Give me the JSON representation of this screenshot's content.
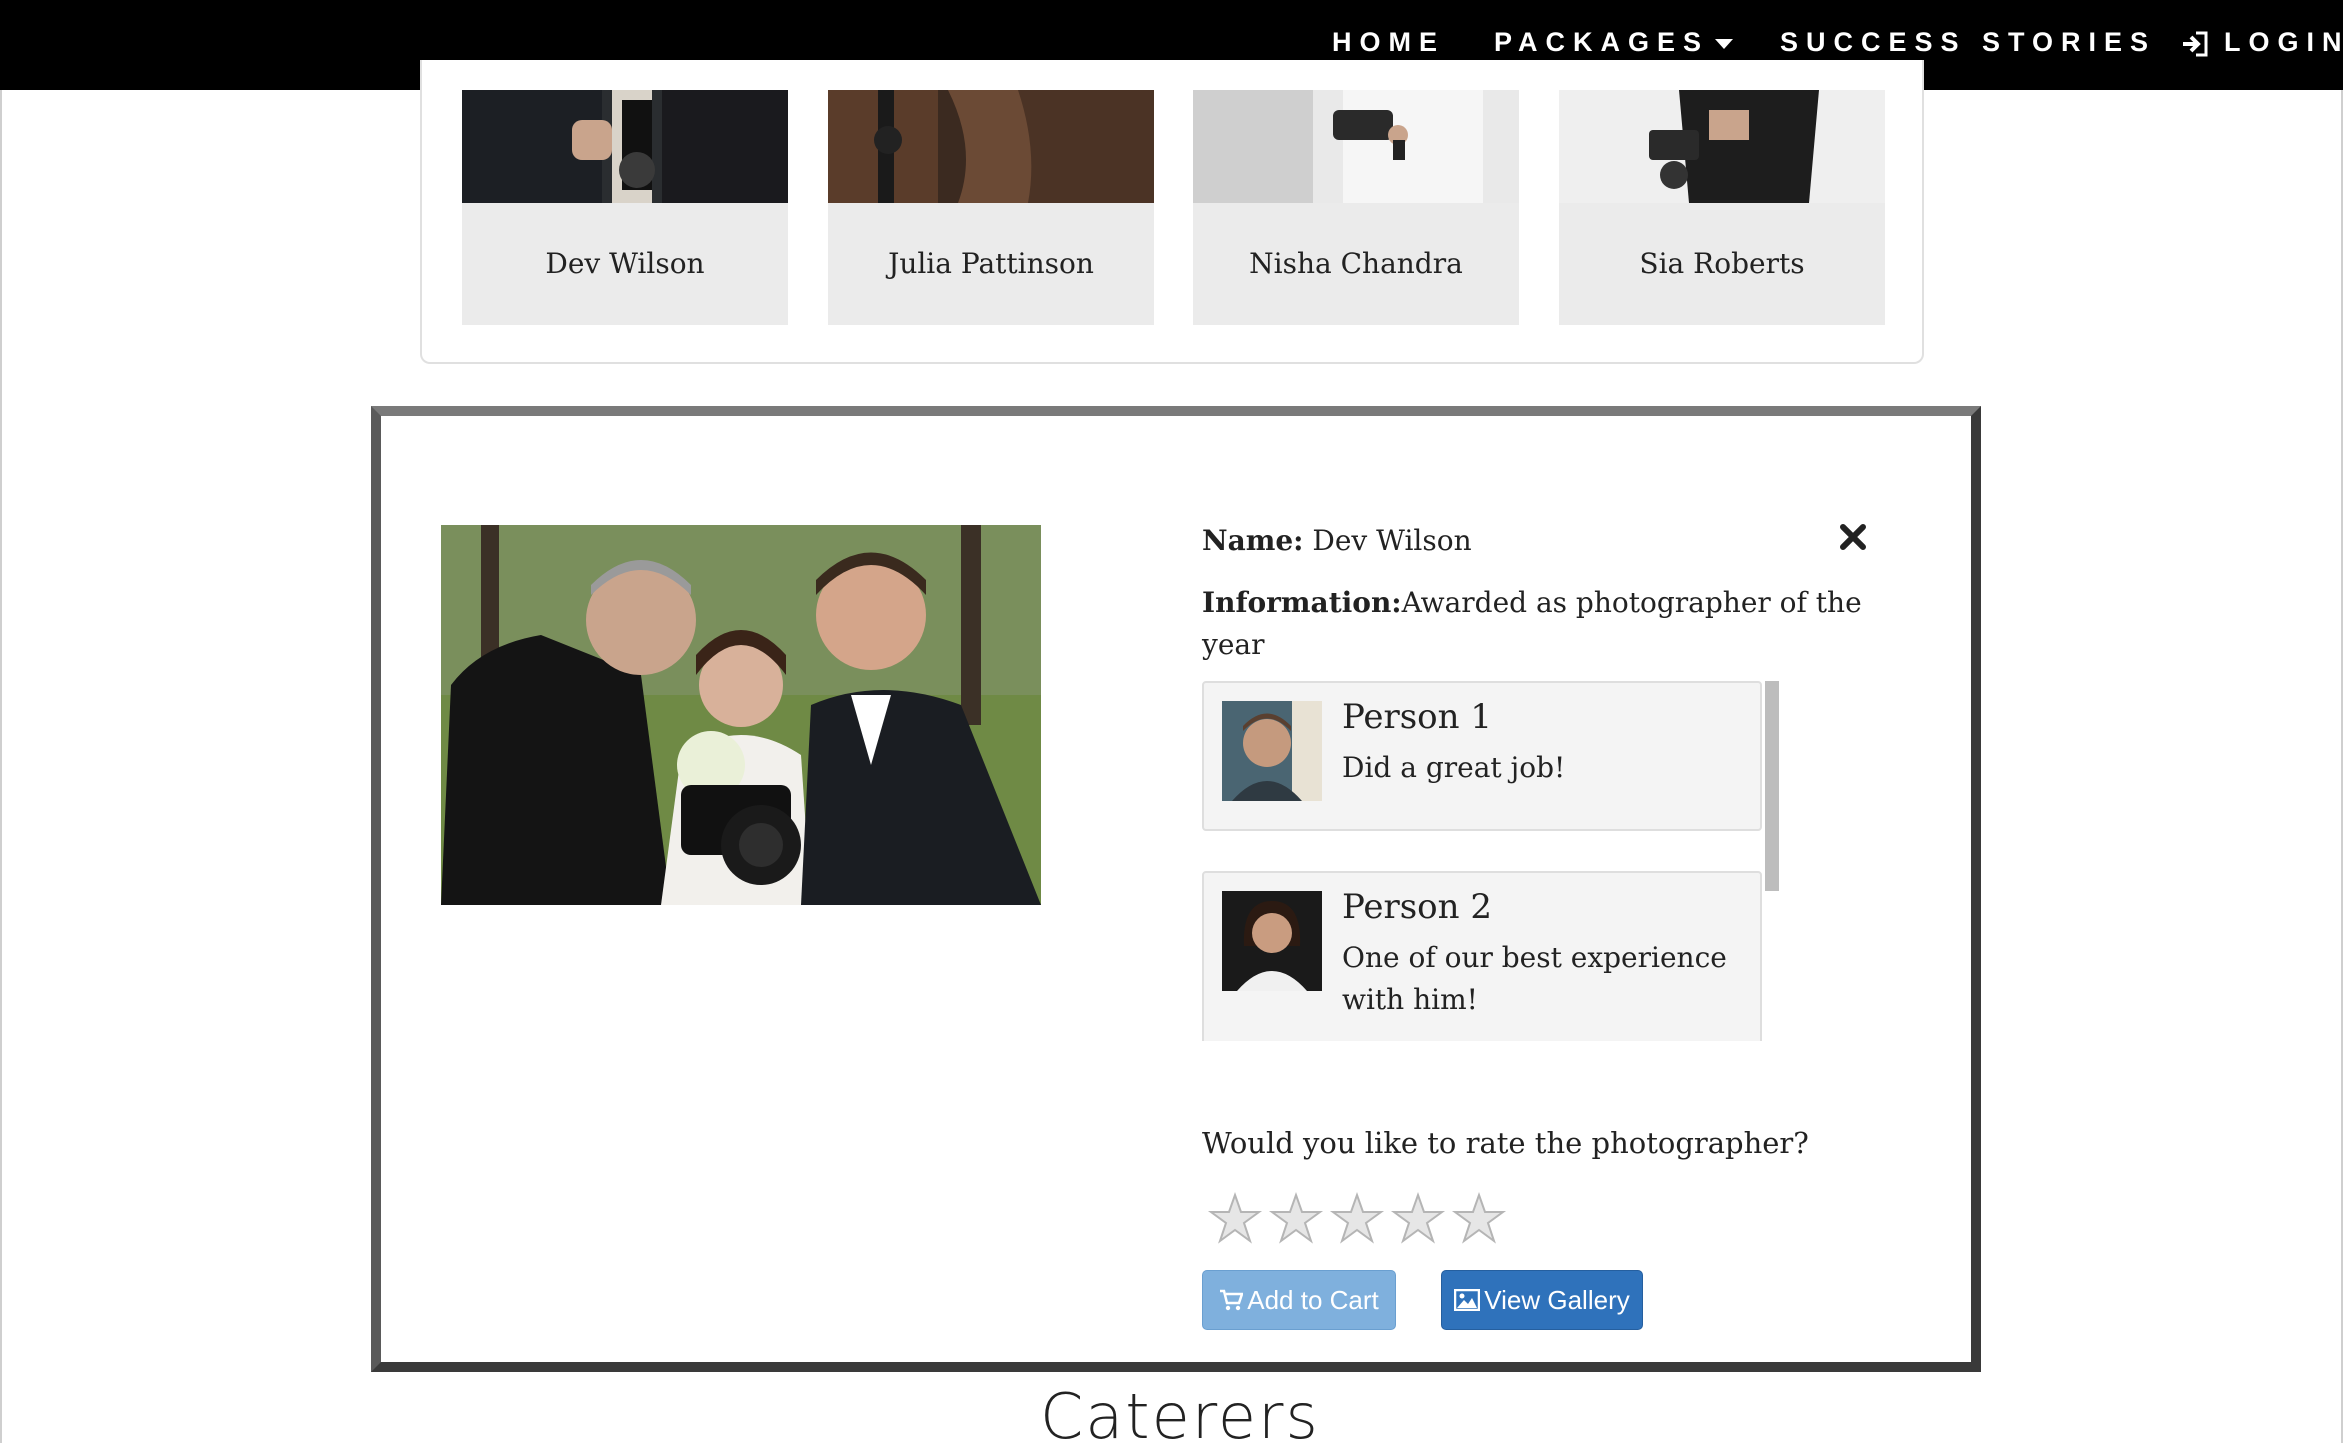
{
  "nav": {
    "items": [
      {
        "label": "HOME"
      },
      {
        "label": "PACKAGES"
      },
      {
        "label": "SUCCESS STORIES"
      },
      {
        "label": "LOGIN"
      }
    ]
  },
  "photographers": [
    {
      "name": "Dev Wilson"
    },
    {
      "name": "Julia Pattinson"
    },
    {
      "name": "Nisha Chandra"
    },
    {
      "name": "Sia Roberts"
    }
  ],
  "detail": {
    "name_label": "Name:",
    "name_value": " Dev Wilson",
    "info_label": "Information:",
    "info_value": "Awarded as photographer of the",
    "info_value_cont": "year",
    "reviews": [
      {
        "name": "Person 1",
        "text": "Did a great job!"
      },
      {
        "name": "Person 2",
        "text": "One of our best experience with him!"
      }
    ],
    "rate_question": "Would you like to rate the photographer?",
    "rating": 0,
    "rating_max": 5,
    "add_to_cart_label": "Add to Cart",
    "view_gallery_label": "View Gallery"
  },
  "section_heading": "Caterers",
  "colors": {
    "nav_bg": "#000000",
    "card_name_bg": "#ebebeb",
    "btn_primary": "#2f72bb",
    "btn_primary_light": "#7fb0dd"
  }
}
